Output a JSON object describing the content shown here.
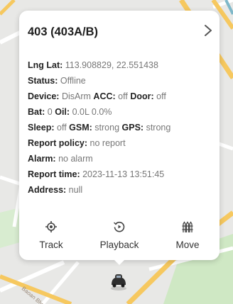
{
  "card": {
    "title": "403 (403A/B)",
    "rows": [
      [
        {
          "k": "Lng Lat:",
          "v": "113.908829, 22.551438"
        }
      ],
      [
        {
          "k": "Status:",
          "v": "Offline"
        }
      ],
      [
        {
          "k": "Device:",
          "v": "DisArm"
        },
        {
          "k": "ACC:",
          "v": "off"
        },
        {
          "k": "Door:",
          "v": "off"
        }
      ],
      [
        {
          "k": "Bat:",
          "v": "0"
        },
        {
          "k": "Oil:",
          "v": "0.0L 0.0%"
        }
      ],
      [
        {
          "k": "Sleep:",
          "v": "off"
        },
        {
          "k": "GSM:",
          "v": "strong"
        },
        {
          "k": "GPS:",
          "v": "strong"
        }
      ],
      [
        {
          "k": "Report policy:",
          "v": "no report"
        }
      ],
      [
        {
          "k": "Alarm:",
          "v": "no alarm"
        }
      ],
      [
        {
          "k": "Report time:",
          "v": "2023-11-13 13:51:45"
        }
      ],
      [
        {
          "k": "Address:",
          "v": "null"
        }
      ]
    ],
    "actions": {
      "track": {
        "label": "Track",
        "icon": "crosshair-icon"
      },
      "playback": {
        "label": "Playback",
        "icon": "replay-icon"
      },
      "move": {
        "label": "Move",
        "icon": "fence-icon"
      }
    }
  },
  "map": {
    "street_label": "Baoan Blvd",
    "colors": {
      "road_major": "#f6c85f",
      "road_minor": "#ffffff",
      "park": "#cfe8c4",
      "water": "#aad3df"
    }
  },
  "colors": {
    "card_bg": "#ffffff",
    "title": "#1e1e1e",
    "key": "#222222",
    "value": "#777777"
  }
}
